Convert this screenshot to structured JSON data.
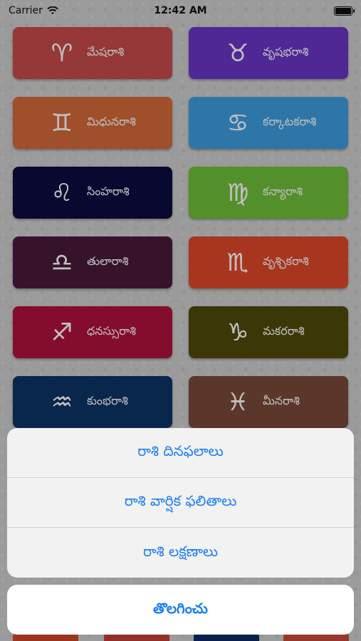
{
  "status_bar": {
    "carrier": "Carrier",
    "time": "12:42 AM"
  },
  "signs": [
    {
      "label": "మేషరాశి",
      "color": "#c94b4b",
      "icon": "♈"
    },
    {
      "label": "వృషభరాశి",
      "color": "#6a36c9",
      "icon": "♉"
    },
    {
      "label": "మిధునరాశి",
      "color": "#d66a3a",
      "icon": "♊"
    },
    {
      "label": "కర్కాటకరాశి",
      "color": "#3f9ee0",
      "icon": "♋"
    },
    {
      "label": "సింహరాశి",
      "color": "#0b0b40",
      "icon": "♌"
    },
    {
      "label": "కన్యారాశి",
      "color": "#6fbf3a",
      "icon": "♍"
    },
    {
      "label": "తులారాశి",
      "color": "#4a1a3a",
      "icon": "♎"
    },
    {
      "label": "వృశ్చికరాశి",
      "color": "#e1482a",
      "icon": "♏"
    },
    {
      "label": "ధనస్సురాశి",
      "color": "#b0103c",
      "icon": "♐"
    },
    {
      "label": "మకరరాశి",
      "color": "#4f4a0a",
      "icon": "♑"
    },
    {
      "label": "కుంభరాశి",
      "color": "#0c3566",
      "icon": "♒"
    },
    {
      "label": "మీనరాశి",
      "color": "#7a4a3a",
      "icon": "♓"
    }
  ],
  "action_sheet": {
    "options": [
      "రాశి దినఫలాలు",
      "రాశి వార్షిక ఫలితాలు",
      "రాశి లక్షణాలు"
    ],
    "cancel": "తొలగించు"
  }
}
